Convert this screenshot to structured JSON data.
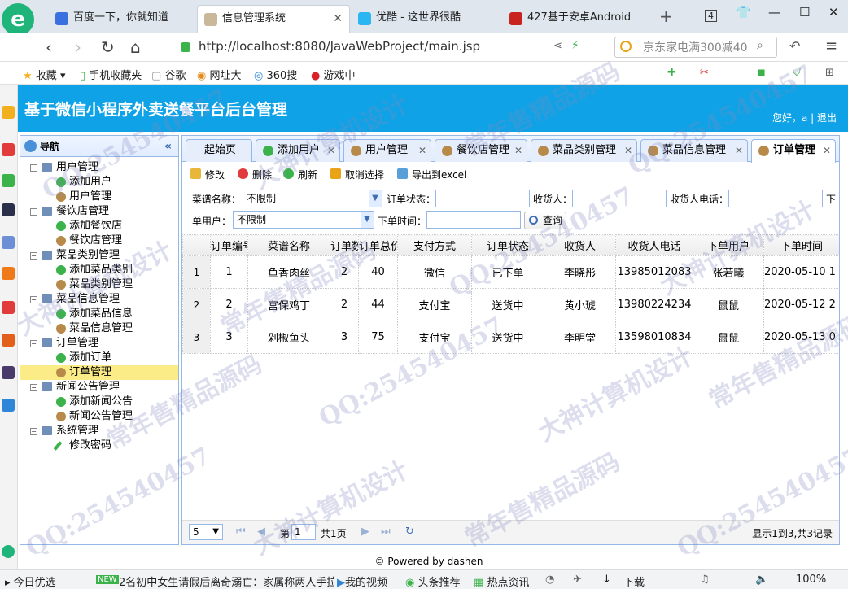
{
  "browser": {
    "tabs": [
      {
        "title": "百度一下，你就知道",
        "active": false
      },
      {
        "title": "信息管理系统",
        "active": true
      },
      {
        "title": "优酷 - 这世界很酷",
        "active": false
      },
      {
        "title": "427基于安卓Android",
        "active": false
      }
    ],
    "tab_count": "4",
    "url": "http://localhost:8080/JavaWebProject/main.jsp",
    "search_text": "京东家电满300减40",
    "bookmarks": [
      "收藏",
      "手机收藏夹",
      "谷歌",
      "网址大",
      "360搜",
      "游戏中"
    ]
  },
  "app": {
    "title": "基于微信小程序外卖送餐平台后台管理",
    "greeting": "您好，a | 退出"
  },
  "nav": {
    "title": "导航",
    "groups": [
      {
        "label": "用户管理",
        "items": [
          "添加用户",
          "用户管理"
        ]
      },
      {
        "label": "餐饮店管理",
        "items": [
          "添加餐饮店",
          "餐饮店管理"
        ]
      },
      {
        "label": "菜品类别管理",
        "items": [
          "添加菜品类别",
          "菜品类别管理"
        ]
      },
      {
        "label": "菜品信息管理",
        "items": [
          "添加菜品信息",
          "菜品信息管理"
        ]
      },
      {
        "label": "订单管理",
        "items": [
          "添加订单",
          "订单管理"
        ]
      },
      {
        "label": "新闻公告管理",
        "items": [
          "添加新闻公告",
          "新闻公告管理"
        ]
      },
      {
        "label": "系统管理",
        "items": [
          "修改密码"
        ]
      }
    ],
    "selected": "订单管理"
  },
  "tabs": [
    "起始页",
    "添加用户",
    "用户管理",
    "餐饮店管理",
    "菜品类别管理",
    "菜品信息管理",
    "订单管理"
  ],
  "toolbar": {
    "edit": "修改",
    "delete": "删除",
    "refresh": "刷新",
    "cancel_select": "取消选择",
    "export": "导出到excel"
  },
  "filters": {
    "dish_label": "菜谱名称：",
    "dish_value": "不限制",
    "status_label": "订单状态：",
    "receiver_label": "收货人：",
    "phone_label": "收货人电话：",
    "order_user_label_1": "下",
    "order_user_label_2": "单用户：",
    "order_user_value": "不限制",
    "time_label": "下单时间：",
    "query": "查询"
  },
  "grid": {
    "columns": [
      "订单编号",
      "菜谱名称",
      "订单数量",
      "订单总价",
      "支付方式",
      "订单状态",
      "收货人",
      "收货人电话",
      "下单用户",
      "下单时间"
    ],
    "rows": [
      {
        "n": "1",
        "cells": [
          "1",
          "鱼香肉丝",
          "2",
          "40",
          "微信",
          "已下单",
          "李晓彤",
          "13985012083",
          "张若曦",
          "2020-05-10 1"
        ]
      },
      {
        "n": "2",
        "cells": [
          "2",
          "宫保鸡丁",
          "2",
          "44",
          "支付宝",
          "送货中",
          "黄小琥",
          "13980224234",
          "鼠鼠",
          "2020-05-12 2"
        ]
      },
      {
        "n": "3",
        "cells": [
          "3",
          "剁椒鱼头",
          "3",
          "75",
          "支付宝",
          "送货中",
          "李明堂",
          "13598010834",
          "鼠鼠",
          "2020-05-13 0"
        ]
      }
    ]
  },
  "pager": {
    "page_size": "5",
    "page_label": "第",
    "page_num": "1",
    "total_pages": "共1页",
    "summary": "显示1到3,共3记录"
  },
  "footer": "© Powered by dashen",
  "statusbar": {
    "items": [
      "今日优选",
      "2名初中女生请假后离奇溺亡：家属称两人手拉",
      "我的视频",
      "头条推荐",
      "热点资讯",
      "下载",
      "100%"
    ],
    "badge": "NEW"
  },
  "watermark": [
    "QQ:254540457",
    "大神计算机设计",
    "常年售精品源码"
  ],
  "colors": {
    "header": "#0fa2e6",
    "panel_border": "#95b8e7",
    "selected": "#fbec88"
  }
}
